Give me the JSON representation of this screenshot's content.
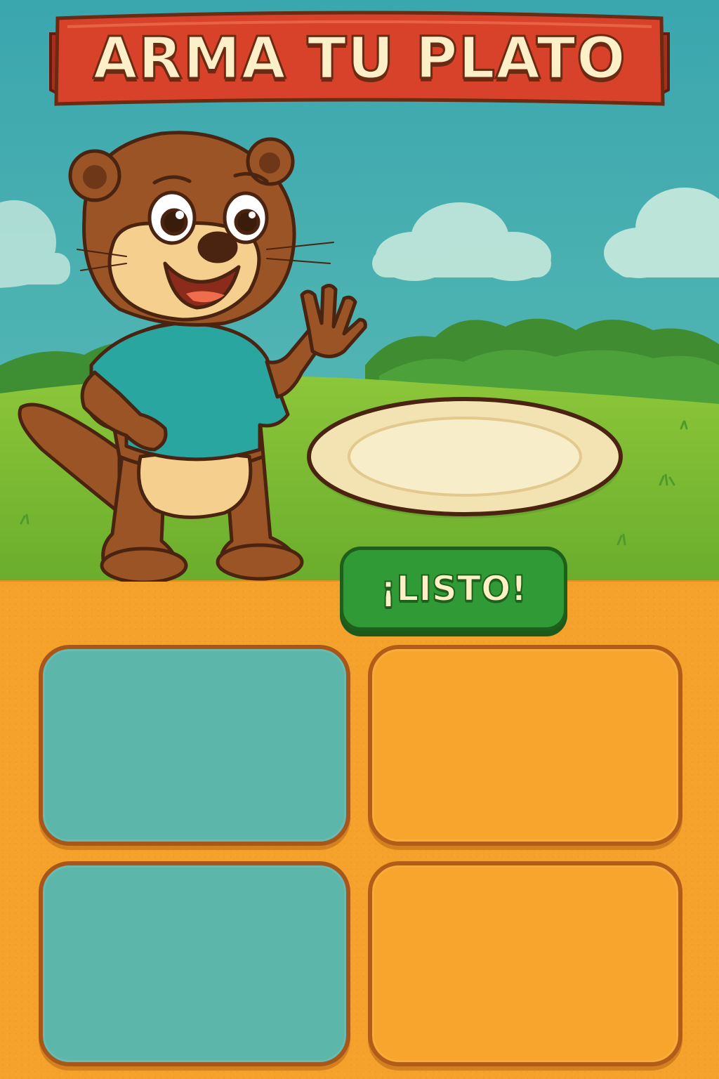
{
  "title": "ARMA TU PLATO",
  "ready_button": {
    "label": "¡LISTO!"
  },
  "colors": {
    "sky": "#42aeb4",
    "banner": "#d9422a",
    "button": "#2f9a36",
    "ground": "#f4a22b",
    "slot_teal": "#5db6aa",
    "slot_orange": "#f7a52c"
  },
  "option_slots": [
    {
      "id": "slot-1",
      "color": "teal"
    },
    {
      "id": "slot-2",
      "color": "orange"
    },
    {
      "id": "slot-3",
      "color": "teal"
    },
    {
      "id": "slot-4",
      "color": "orange"
    }
  ],
  "character": {
    "icon": "otter-mascot-icon"
  },
  "plate": {
    "icon": "empty-plate-icon"
  }
}
